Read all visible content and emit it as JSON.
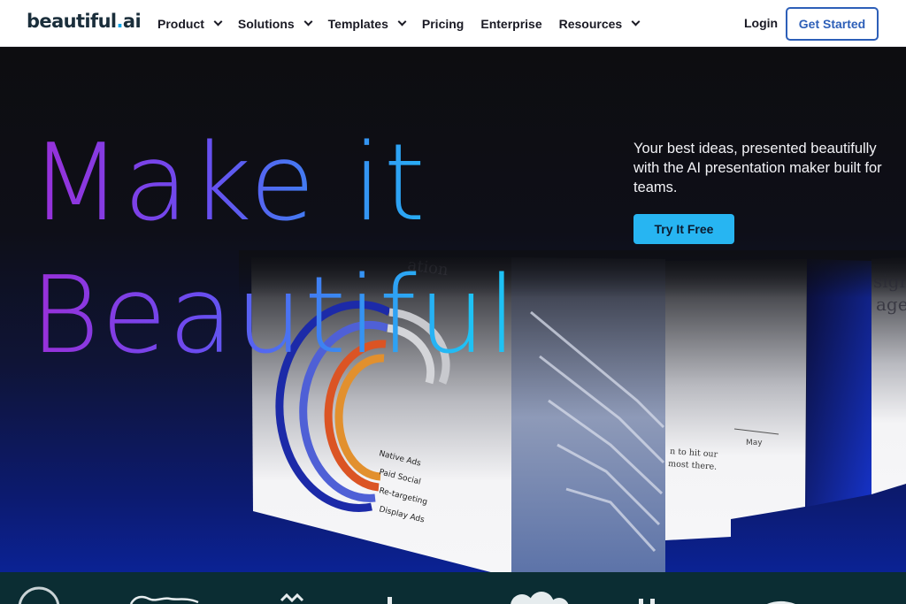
{
  "brand": {
    "name": "beautiful",
    "dot": ".",
    "suffix": "ai"
  },
  "nav": {
    "items": [
      {
        "label": "Product",
        "has_dropdown": true
      },
      {
        "label": "Solutions",
        "has_dropdown": true
      },
      {
        "label": "Templates",
        "has_dropdown": true
      },
      {
        "label": "Pricing",
        "has_dropdown": false
      },
      {
        "label": "Enterprise",
        "has_dropdown": false
      },
      {
        "label": "Resources",
        "has_dropdown": true
      }
    ],
    "login": "Login",
    "cta": "Get Started"
  },
  "hero": {
    "title_line1": "Make it",
    "title_line2": "Beautiful",
    "subtitle": "Your best ideas, presented beautifully with the AI presentation maker built for teams.",
    "cta": "Try It Free",
    "slide_chart_legend": [
      "Native Ads",
      "Paid Social",
      "Re-targeting",
      "Display Ads"
    ],
    "slide_text_a": [
      "n to hit our",
      "most there."
    ],
    "slide_text_b": "May",
    "slide_text_c": [
      "sign",
      "age"
    ]
  },
  "colors": {
    "accent": "#27b5f2",
    "brand_dark": "#1a2e3b",
    "cta_border": "#2d5fb8",
    "gradient_purple": "#9a2fd8",
    "gradient_cyan": "#1ec2f5",
    "strip_bg": "#0b2d33"
  }
}
